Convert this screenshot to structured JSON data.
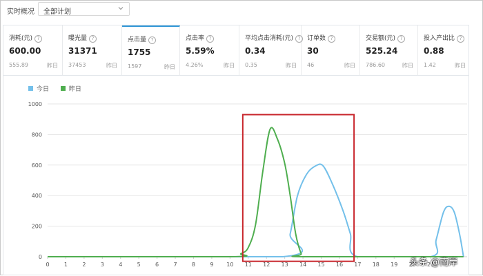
{
  "header": {
    "title": "实时概况",
    "plan_select_value": "全部计划"
  },
  "metrics": [
    {
      "name": "消耗(元)",
      "value": "600.00",
      "prev_value": "555.89",
      "prev_label": "昨日"
    },
    {
      "name": "曝光量",
      "value": "31371",
      "prev_value": "37453",
      "prev_label": "昨日"
    },
    {
      "name": "点击量",
      "value": "1755",
      "prev_value": "1597",
      "prev_label": "昨日",
      "active": true
    },
    {
      "name": "点击率",
      "value": "5.59%",
      "prev_value": "4.26%",
      "prev_label": "昨日"
    },
    {
      "name": "平均点击消耗(元)",
      "value": "0.34",
      "prev_value": "0.35",
      "prev_label": "昨日"
    },
    {
      "name": "订单数",
      "value": "30",
      "prev_value": "46",
      "prev_label": "昨日"
    },
    {
      "name": "交易额(元)",
      "value": "525.24",
      "prev_value": "786.60",
      "prev_label": "昨日"
    },
    {
      "name": "投入产出比",
      "value": "0.88",
      "prev_value": "1.42",
      "prev_label": "昨日"
    }
  ],
  "colors": {
    "today": "#74c0ea",
    "yesterday": "#4fae4f",
    "highlight_box": "#c8262c",
    "active_tab": "#2f96d6"
  },
  "icons": {
    "select_chevron": "chevron-down-icon",
    "metric_help": "question-circle-icon"
  },
  "chart_data": {
    "type": "line",
    "ylim": [
      0,
      1000
    ],
    "yticks": [
      0,
      200,
      400,
      600,
      800,
      1000
    ],
    "xlim": [
      0,
      23
    ],
    "xticks": [
      0,
      1,
      2,
      3,
      4,
      5,
      6,
      7,
      8,
      9,
      10,
      11,
      12,
      13,
      14,
      15,
      16,
      17,
      18,
      19,
      20,
      21
    ],
    "grid": "horizontal",
    "legend_position": "top-left",
    "series": [
      {
        "name": "今日",
        "color": "#74c0ea",
        "points": [
          [
            0,
            0
          ],
          [
            12.9,
            0
          ],
          [
            13.3,
            150
          ],
          [
            13.7,
            400
          ],
          [
            14.2,
            540
          ],
          [
            14.7,
            595
          ],
          [
            15.1,
            595
          ],
          [
            15.6,
            480
          ],
          [
            16.2,
            300
          ],
          [
            16.6,
            150
          ],
          [
            17.0,
            0
          ],
          [
            21.0,
            0
          ],
          [
            21.3,
            110
          ],
          [
            21.7,
            290
          ],
          [
            22.0,
            330
          ],
          [
            22.3,
            290
          ],
          [
            22.6,
            140
          ],
          [
            22.8,
            0
          ]
        ]
      },
      {
        "name": "昨日",
        "color": "#4fae4f",
        "points": [
          [
            0,
            0
          ],
          [
            10.0,
            0
          ],
          [
            10.6,
            20
          ],
          [
            11.0,
            60
          ],
          [
            11.4,
            210
          ],
          [
            11.8,
            560
          ],
          [
            12.2,
            835
          ],
          [
            12.6,
            770
          ],
          [
            13.0,
            610
          ],
          [
            13.3,
            400
          ],
          [
            13.6,
            150
          ],
          [
            13.9,
            20
          ],
          [
            14.1,
            0
          ],
          [
            22.8,
            0
          ]
        ]
      }
    ],
    "highlight_range": {
      "x": [
        10.7,
        16.8
      ],
      "y": [
        -30,
        930
      ]
    }
  },
  "watermark": "头条 @南岸"
}
